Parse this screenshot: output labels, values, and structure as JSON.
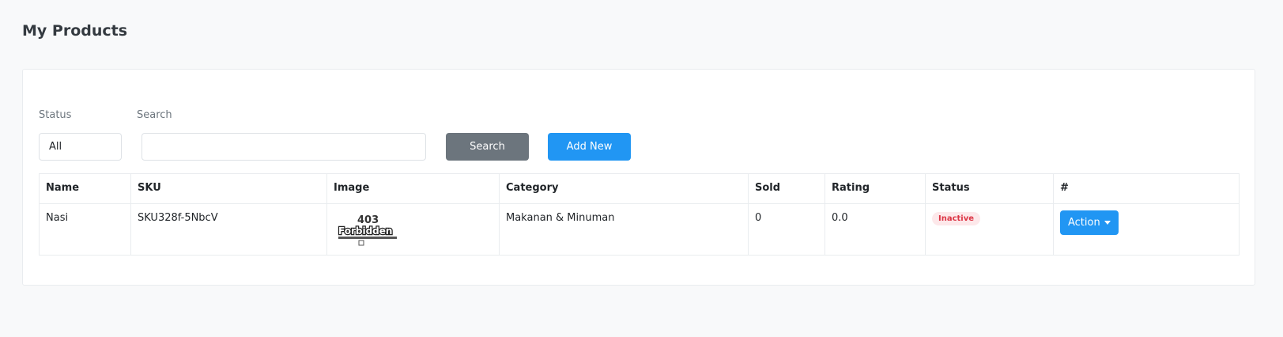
{
  "page": {
    "title": "My Products"
  },
  "filters": {
    "status_label": "Status",
    "status_value": "All",
    "search_label": "Search",
    "search_value": "",
    "search_button": "Search",
    "add_button": "Add New"
  },
  "table": {
    "headers": [
      "Name",
      "SKU",
      "Image",
      "Category",
      "Sold",
      "Rating",
      "Status",
      "#"
    ],
    "rows": [
      {
        "name": "Nasi",
        "sku": "SKU328f-5NbcV",
        "image_text": "403 Forbidden",
        "category": "Makanan & Minuman",
        "sold": "0",
        "rating": "0.0",
        "status": "Inactive",
        "action": "Action"
      }
    ]
  },
  "colors": {
    "primary": "#2196f3",
    "secondary": "#6c757d",
    "danger": "#dc3545",
    "badge_bg": "#fde8ea"
  }
}
